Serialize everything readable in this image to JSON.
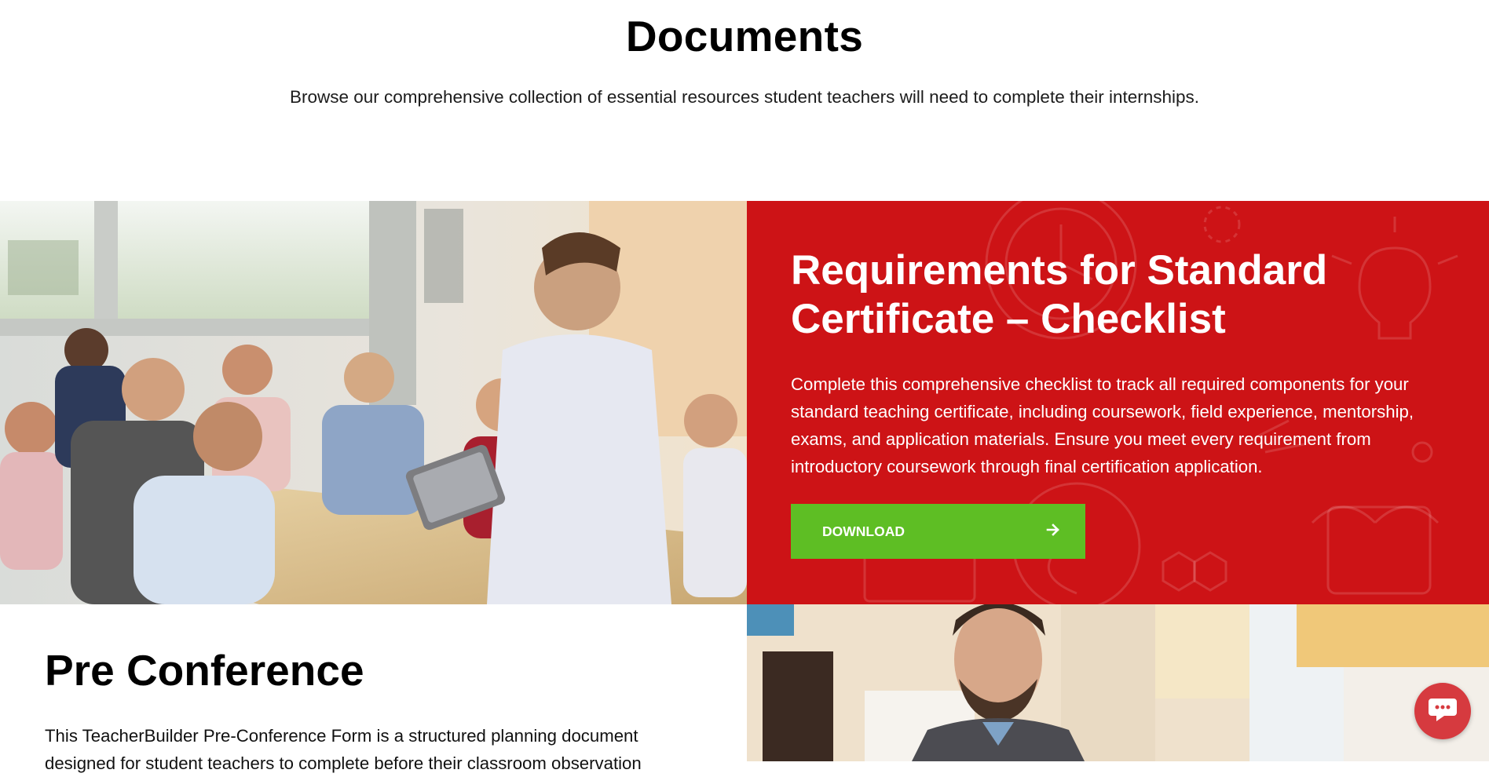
{
  "header": {
    "title": "Documents",
    "intro": "Browse our comprehensive collection of essential resources student teachers will need to complete their internships."
  },
  "documents": [
    {
      "title": "Requirements for Standard Certificate – Checklist",
      "description": "Complete this comprehensive checklist to track all required components for your standard teaching certificate, including coursework, field experience, mentorship, exams, and application materials. Ensure you meet every requirement from introductory coursework through final certification application.",
      "button_label": "DOWNLOAD",
      "image": "classroom-discussion-photo"
    },
    {
      "title": "Pre Conference",
      "description": "This TeacherBuilder Pre-Conference Form is a structured planning document designed for student teachers to complete before their classroom observation",
      "image": "teacher-portrait-photo"
    }
  ],
  "icons": {
    "download_arrow": "arrow-right-icon",
    "chat": "chat-bubble-icon"
  },
  "colors": {
    "accent_red": "#cd1316",
    "download_green": "#5ebe24",
    "chat_red": "#d63a3f"
  }
}
